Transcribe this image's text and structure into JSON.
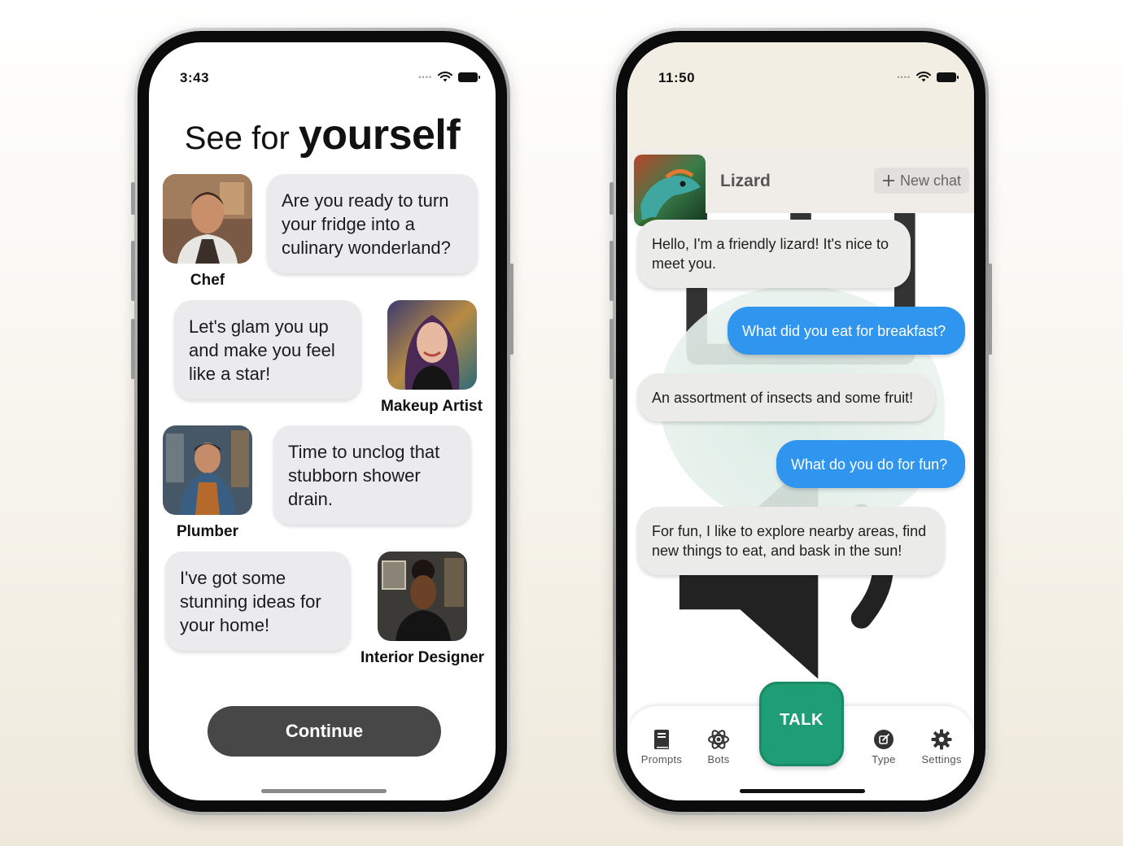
{
  "left_phone": {
    "status_time": "3:43",
    "title_light": "See for",
    "title_bold": "yourself",
    "personas": [
      {
        "name": "Chef",
        "message": "Are you ready to turn your fridge into a culinary wonderland?"
      },
      {
        "name": "Makeup Artist",
        "message": "Let's glam you up and make you feel like a star!"
      },
      {
        "name": "Plumber",
        "message": "Time to unclog that stubborn shower drain."
      },
      {
        "name": "Interior Designer",
        "message": "I've got some stunning ideas for your home!"
      }
    ],
    "continue_label": "Continue"
  },
  "right_phone": {
    "status_time": "11:50",
    "bot_name": "Lizard",
    "new_chat_label": "New chat",
    "messages": [
      {
        "from": "bot",
        "text": "Hello, I'm a friendly lizard! It's nice to meet you."
      },
      {
        "from": "user",
        "text": "What did you eat for breakfast?"
      },
      {
        "from": "bot",
        "text": "An assortment of insects and some fruit!"
      },
      {
        "from": "user",
        "text": "What do you do for fun?"
      },
      {
        "from": "bot",
        "text": "For fun, I like to explore nearby areas, find new things to eat, and bask in the sun!"
      }
    ],
    "talk_label": "TALK",
    "tabs": [
      {
        "label": "Prompts",
        "icon": "book-icon"
      },
      {
        "label": "Bots",
        "icon": "atom-icon"
      },
      {
        "label": "Type",
        "icon": "compose-icon"
      },
      {
        "label": "Settings",
        "icon": "gear-icon"
      }
    ],
    "toolbar_icons": [
      "share-icon",
      "speaker-icon",
      "crown-icon"
    ]
  },
  "colors": {
    "user_bubble": "#2f95ee",
    "bot_bubble": "#ebebea",
    "talk_button": "#1f9e76",
    "continue_button": "#474747",
    "header_bg": "#f2eee4"
  }
}
